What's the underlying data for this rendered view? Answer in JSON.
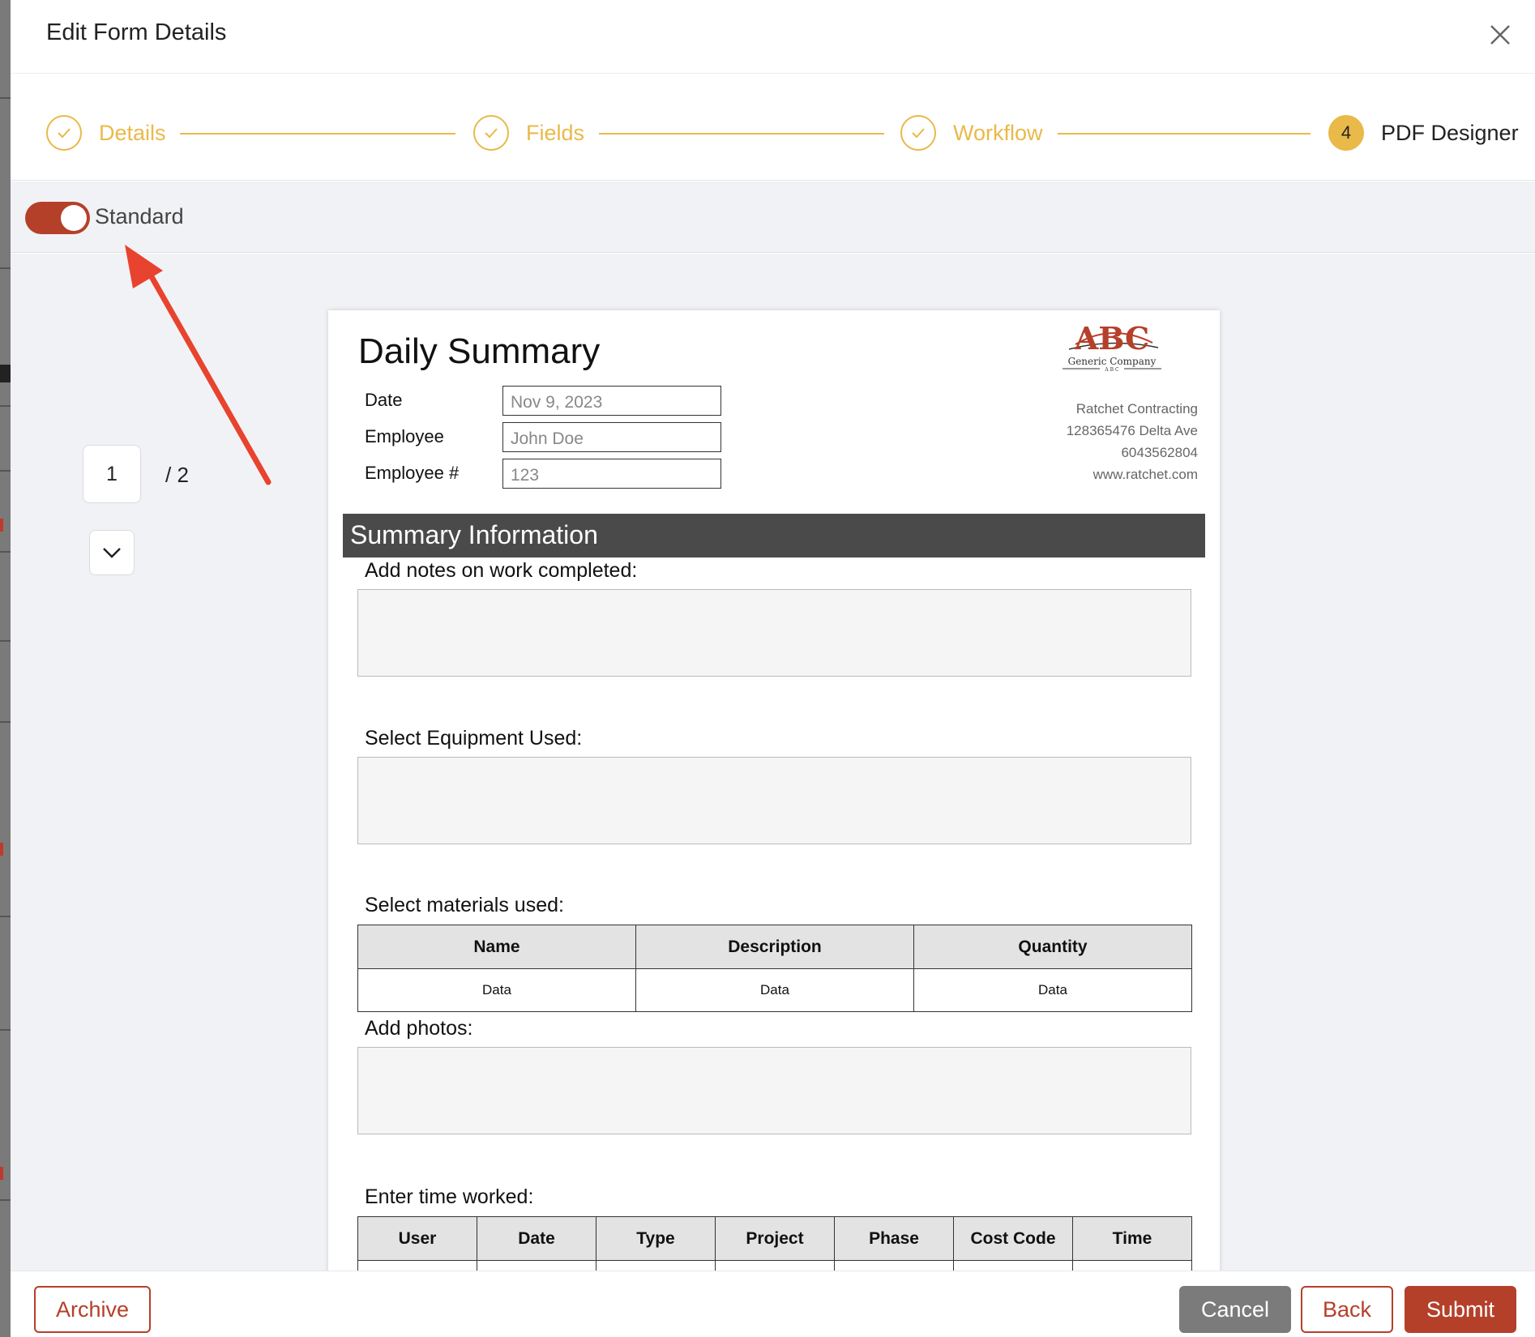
{
  "modal": {
    "title": "Edit Form Details"
  },
  "steps": [
    {
      "label": "Details",
      "state": "done"
    },
    {
      "label": "Fields",
      "state": "done"
    },
    {
      "label": "Workflow",
      "state": "done"
    },
    {
      "number": "4",
      "label": "PDF Designer",
      "state": "active"
    }
  ],
  "toolbar": {
    "toggle_label": "Standard",
    "toggle_on": true
  },
  "pager": {
    "current": "1",
    "total": "/ 2"
  },
  "pdf": {
    "title": "Daily Summary",
    "fields": [
      {
        "label": "Date",
        "value": "Nov 9, 2023"
      },
      {
        "label": "Employee",
        "value": "John Doe"
      },
      {
        "label": "Employee #",
        "value": "123"
      }
    ],
    "logo": {
      "text": "ABC",
      "subtext": "Generic Company",
      "small": "A B C"
    },
    "company": {
      "name": "Ratchet Contracting",
      "address": "128365476 Delta Ave",
      "phone": "6043562804",
      "website": "www.ratchet.com"
    },
    "section_title": "Summary Information",
    "notes_label": "Add notes on work completed:",
    "equipment_label": "Select Equipment Used:",
    "materials_label": "Select materials used:",
    "materials_table": {
      "headers": [
        "Name",
        "Description",
        "Quantity"
      ],
      "rows": [
        [
          "Data",
          "Data",
          "Data"
        ]
      ]
    },
    "photos_label": "Add photos:",
    "time_label": "Enter time worked:",
    "time_table": {
      "headers": [
        "User",
        "Date",
        "Type",
        "Project",
        "Phase",
        "Cost Code",
        "Time"
      ]
    }
  },
  "footer": {
    "archive": "Archive",
    "cancel": "Cancel",
    "back": "Back",
    "submit": "Submit"
  },
  "colors": {
    "accent": "#b5402a",
    "step": "#e9b949",
    "annotation": "#e8432e"
  }
}
